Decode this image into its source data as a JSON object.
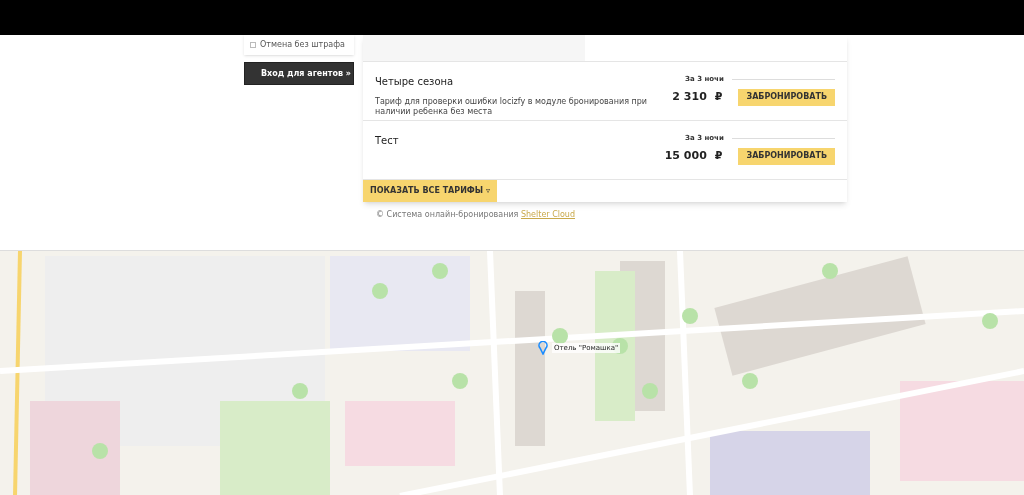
{
  "sidebar": {
    "filters": [
      {
        "label": "Отмена без штрафа",
        "checked": false
      }
    ],
    "agent_button": "Вход для агентов »"
  },
  "tariffs": [
    {
      "name": "Четыре сезона",
      "description": "Тариф для проверки ошибки locizfy в модуле бронирования при наличии ребенка без места",
      "period": "За 3 ночи",
      "price": "2 310",
      "currency": "₽",
      "book_button": "ЗАБРОНИРОВАТЬ"
    },
    {
      "name": "Тест",
      "period": "За 3 ночи",
      "price": "15 000",
      "currency": "₽",
      "book_button": "ЗАБРОНИРОВАТЬ"
    }
  ],
  "show_all_button": "ПОКАЗАТЬ ВСЕ ТАРИФЫ ▿",
  "footer": {
    "text": "© Система онлайн-бронирования ",
    "link": "Shelter Cloud"
  },
  "map": {
    "pin_label": "Отель \"Ромашка\""
  }
}
